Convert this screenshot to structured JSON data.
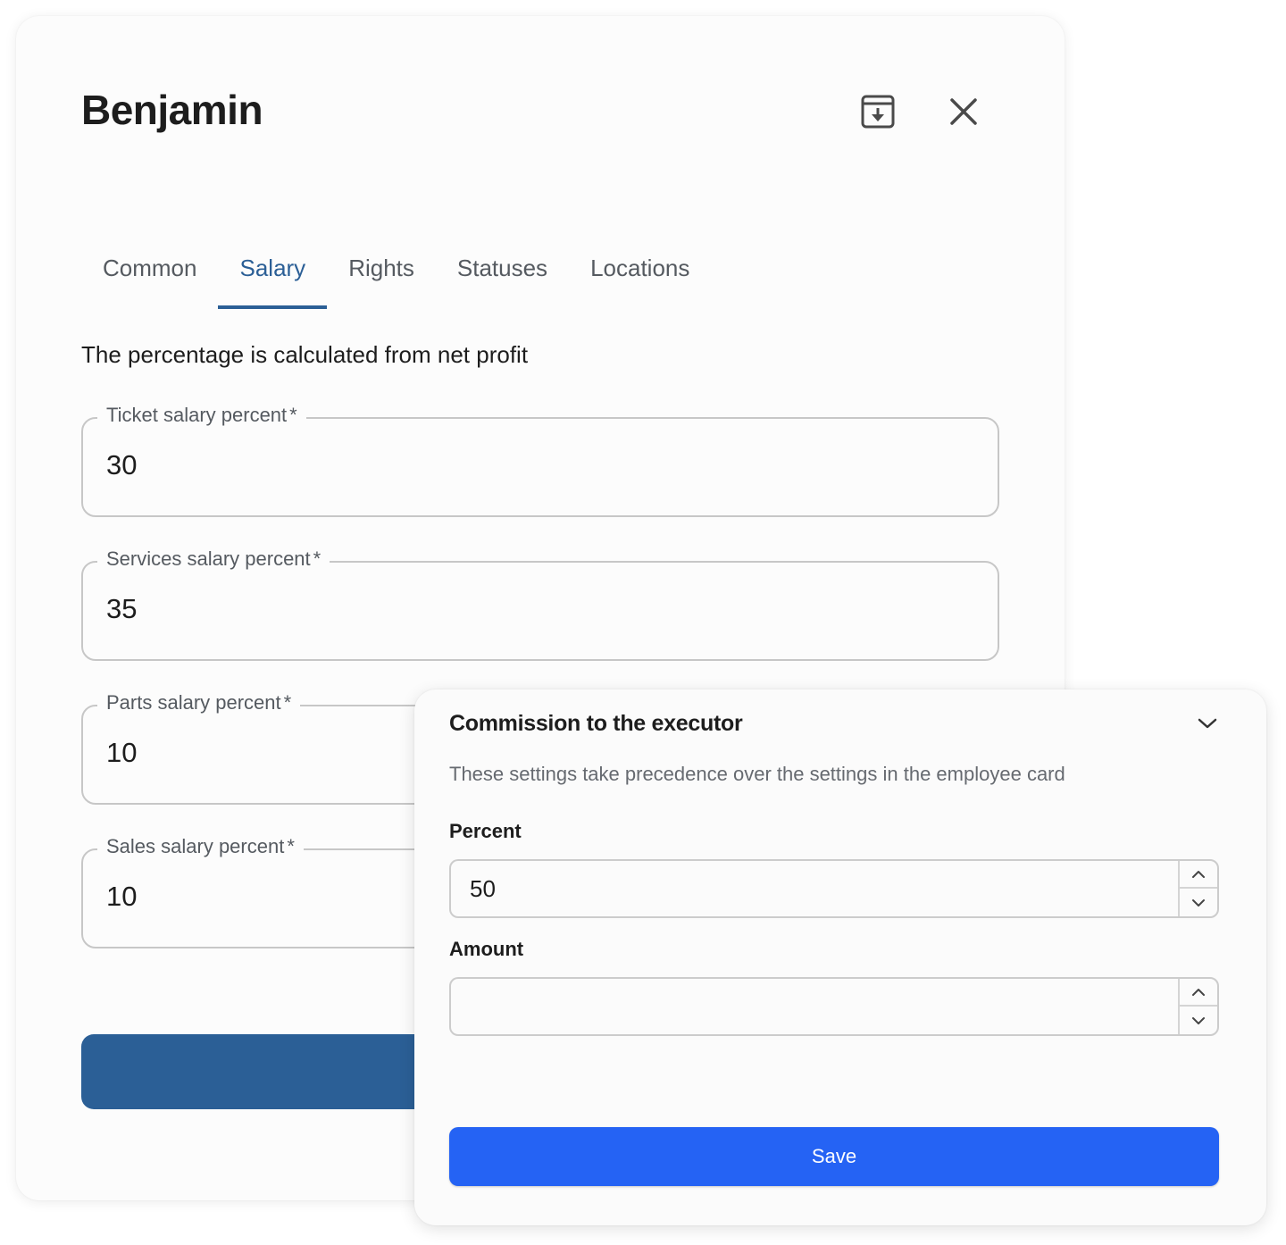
{
  "dialog": {
    "title": "Benjamin",
    "archive_icon": "archive-download-icon",
    "close_icon": "close-icon"
  },
  "tabs": [
    {
      "label": "Common",
      "active": false
    },
    {
      "label": "Salary",
      "active": true
    },
    {
      "label": "Rights",
      "active": false
    },
    {
      "label": "Statuses",
      "active": false
    },
    {
      "label": "Locations",
      "active": false
    }
  ],
  "salary": {
    "hint": "The percentage is calculated from net profit",
    "fields": [
      {
        "label": "Ticket salary percent",
        "required": "*",
        "value": "30"
      },
      {
        "label": "Services salary percent",
        "required": "*",
        "value": "35"
      },
      {
        "label": "Parts salary percent",
        "required": "*",
        "value": "10"
      },
      {
        "label": "Sales salary percent",
        "required": "*",
        "value": "10"
      }
    ]
  },
  "commission": {
    "title": "Commission to the executor",
    "description": "These settings take precedence over the settings in the employee card",
    "percent_label": "Percent",
    "percent_value": "50",
    "amount_label": "Amount",
    "amount_value": "",
    "save_label": "Save"
  },
  "colors": {
    "accent": "#2b5f96",
    "save_button": "#2563f4"
  }
}
